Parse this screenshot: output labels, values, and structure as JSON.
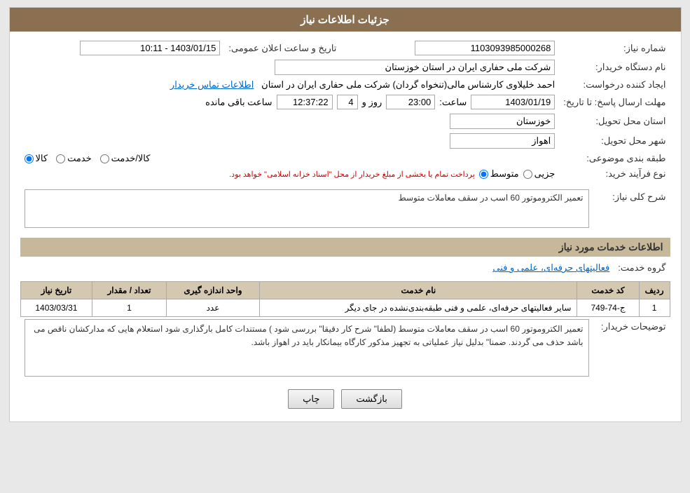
{
  "header": {
    "title": "جزئیات اطلاعات نیاز"
  },
  "fields": {
    "need_number_label": "شماره نیاز:",
    "need_number_value": "1103093985000268",
    "announce_date_label": "تاریخ و ساعت اعلان عمومی:",
    "announce_date_value": "1403/01/15 - 10:11",
    "buyer_org_label": "نام دستگاه خریدار:",
    "buyer_org_value": "شرکت ملی حفاری ایران در استان خوزستان",
    "creator_label": "ایجاد کننده درخواست:",
    "creator_value": "احمد خلیلاوی کارشناس مالی(تنخواه گردان) شرکت ملی حفاری ایران در استان",
    "contact_info_label": "اطلاعات تماس خریدار",
    "deadline_label": "مهلت ارسال پاسخ: تا تاریخ:",
    "deadline_date": "1403/01/19",
    "deadline_time_label": "ساعت:",
    "deadline_time": "23:00",
    "deadline_day_label": "روز و",
    "deadline_days": "4",
    "deadline_remaining_label": "ساعت باقی مانده",
    "deadline_remaining": "12:37:22",
    "province_label": "استان محل تحویل:",
    "province_value": "خوزستان",
    "city_label": "شهر محل تحویل:",
    "city_value": "اهواز",
    "category_label": "طبقه بندی موضوعی:",
    "category_kala": "کالا",
    "category_khedmat": "خدمت",
    "category_kala_khedmat": "کالا/خدمت",
    "purchase_type_label": "نوع فرآیند خرید:",
    "purchase_jozei": "جزیی",
    "purchase_mottaset": "متوسط",
    "purchase_note": "پرداخت تمام یا بخشی از مبلغ خریدار از محل \"اسناد خزانه اسلامی\" خواهد بود.",
    "need_desc_label": "شرح کلی نیاز:",
    "need_desc_value": "تعمیر الکتروموتور 60 اسب در سقف معاملات متوسط",
    "services_section_label": "اطلاعات خدمات مورد نیاز",
    "service_group_label": "گروه خدمت:",
    "service_group_value": "فعالیتهای حرفه‌ای، علمی و فنی",
    "table_headers": {
      "row_num": "ردیف",
      "code": "کد خدمت",
      "name": "نام خدمت",
      "unit": "واحد اندازه گیری",
      "count": "تعداد / مقدار",
      "date": "تاریخ نیاز"
    },
    "table_rows": [
      {
        "row_num": "1",
        "code": "ج-74-749",
        "name": "سایر فعالیتهای حرفه‌ای، علمی و فنی طبقه‌بندی‌نشده در جای دیگر",
        "unit": "عدد",
        "count": "1",
        "date": "1403/03/31"
      }
    ],
    "buyer_desc_label": "توضیحات خریدار:",
    "buyer_desc_value": "تعمیر الکتروموتور 60 اسب در سقف معاملات متوسط (لطفا\" شرح کار دقیقا\" بررسی شود ) مستندات کامل بارگذاری شود استعلام هایی که مدارکشان ناقص می باشد حذف می گردند.  ضمنا\" بدلیل نیاز عملیاتی به تجهیز مذکور کارگاه بیمانکار باید در اهواز باشد.",
    "buttons": {
      "print": "چاپ",
      "back": "بازگشت"
    }
  }
}
